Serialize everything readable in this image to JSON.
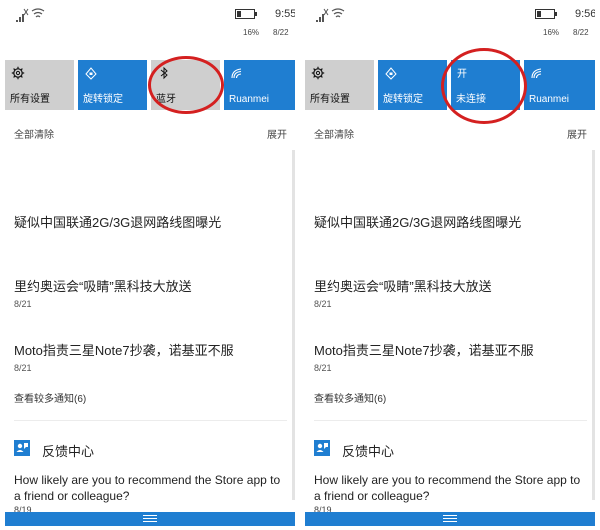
{
  "left": {
    "status": {
      "time": "9:55",
      "battery_pct": "16%",
      "date": "8/22"
    },
    "tiles": [
      {
        "id": "settings",
        "label": "所有设置",
        "top": "",
        "style": "gray",
        "icon": "gear-icon"
      },
      {
        "id": "rotation",
        "label": "旋转锁定",
        "top": "",
        "style": "blue",
        "icon": "rotation-lock-icon"
      },
      {
        "id": "bluetooth",
        "label": "蓝牙",
        "top": "",
        "style": "gray",
        "icon": "bluetooth-icon"
      },
      {
        "id": "wifi",
        "label": "Ruanmei",
        "top": "",
        "style": "blue",
        "icon": "wifi-icon"
      }
    ],
    "clear_all": "全部清除",
    "expand": "展开",
    "news": [
      {
        "title": "疑似中国联通2G/3G退网路线图曝光",
        "date": ""
      },
      {
        "title": "里约奥运会“吸睛”黑科技大放送",
        "date": "8/21"
      },
      {
        "title": "Moto指责三星Note7抄袭，诺基亚不服",
        "date": "8/21"
      }
    ],
    "more": "查看较多通知(6)",
    "feedback_title": "反馈中心",
    "question": "How likely are you to recommend the Store app to a friend or colleague?",
    "question_date": "8/19"
  },
  "right": {
    "status": {
      "time": "9:56",
      "battery_pct": "16%",
      "date": "8/22"
    },
    "tiles": [
      {
        "id": "settings",
        "label": "所有设置",
        "top": "",
        "style": "gray",
        "icon": "gear-icon"
      },
      {
        "id": "rotation",
        "label": "旋转锁定",
        "top": "",
        "style": "blue",
        "icon": "rotation-lock-icon"
      },
      {
        "id": "bluetooth",
        "label": "未连接",
        "top": "开",
        "style": "blue",
        "icon": ""
      },
      {
        "id": "wifi",
        "label": "Ruanmei",
        "top": "",
        "style": "blue",
        "icon": "wifi-icon"
      }
    ],
    "clear_all": "全部清除",
    "expand": "展开",
    "news": [
      {
        "title": "疑似中国联通2G/3G退网路线图曝光",
        "date": ""
      },
      {
        "title": "里约奥运会“吸睛”黑科技大放送",
        "date": "8/21"
      },
      {
        "title": "Moto指责三星Note7抄袭，诺基亚不服",
        "date": "8/21"
      }
    ],
    "more": "查看较多通知(6)",
    "feedback_title": "反馈中心",
    "question": "How likely are you to recommend the Store app to a friend or colleague?",
    "question_date": "8/19"
  },
  "colors": {
    "accent": "#1f7ed1",
    "tile_gray": "#cfcfcf",
    "annotation": "#d42020"
  }
}
